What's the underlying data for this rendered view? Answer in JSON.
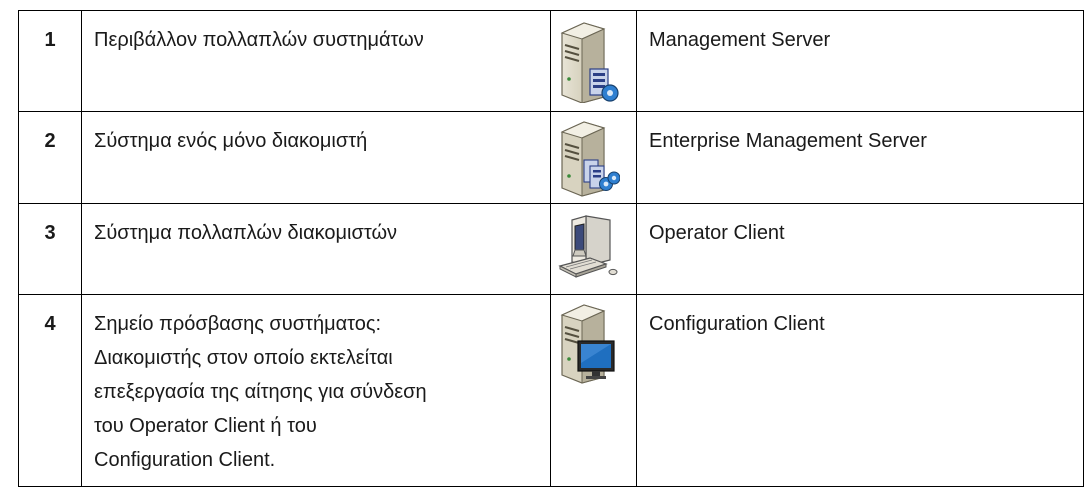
{
  "rows": [
    {
      "number": "1",
      "description": "Περιβάλλον πολλαπλών συστημάτων",
      "icon": "management-server-icon",
      "name": "Management Server"
    },
    {
      "number": "2",
      "description": "Σύστημα ενός μόνο διακομιστή",
      "icon": "enterprise-management-server-icon",
      "name": "Enterprise Management Server"
    },
    {
      "number": "3",
      "description": "Σύστημα πολλαπλών διακομιστών",
      "icon": "operator-client-icon",
      "name": "Operator Client"
    },
    {
      "number": "4",
      "description": "Σημείο πρόσβασης συστήματος:\nΔιακομιστής στον οποίο εκτελείται\nεπεξεργασία της αίτησης για σύνδεση\nτου Operator Client ή του\nConfiguration Client.",
      "icon": "configuration-client-icon",
      "name": "Configuration Client"
    }
  ]
}
